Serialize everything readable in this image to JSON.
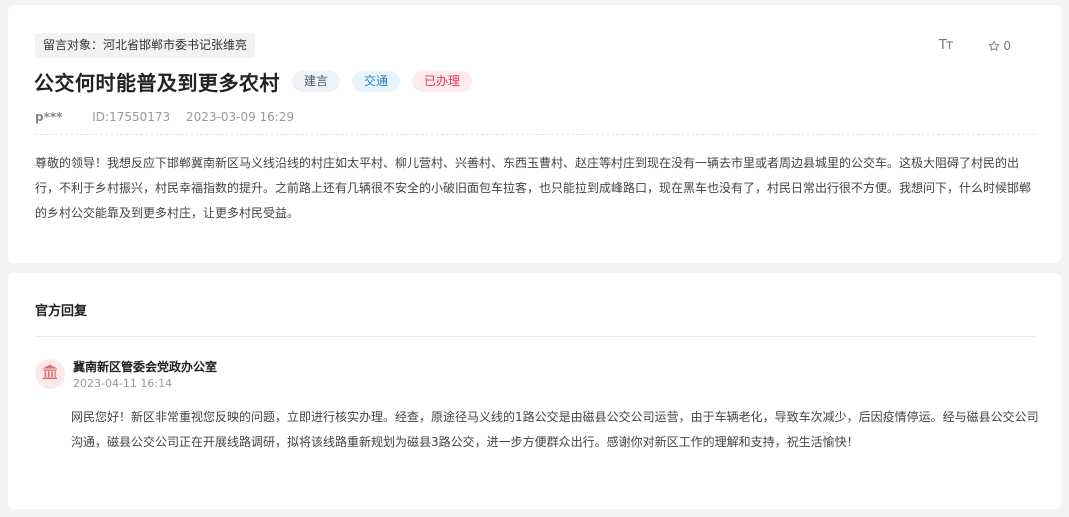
{
  "message": {
    "target": "留言对象：河北省邯郸市委书记张维亮",
    "title": "公交何时能普及到更多农村",
    "tags": [
      "建言",
      "交通",
      "已办理"
    ],
    "tools": {
      "font_icon": "Tт",
      "favorite_count": "0"
    },
    "author": "p***",
    "id_text": "ID:17550173",
    "timestamp": "2023-03-09 16:29",
    "content": "尊敬的领导！我想反应下邯郸冀南新区马义线沿线的村庄如太平村、柳儿营村、兴善村、东西玉曹村、赵庄等村庄到现在没有一辆去市里或者周边县城里的公交车。这极大阻碍了村民的出行，不利于乡村振兴，村民幸福指数的提升。之前路上还有几辆很不安全的小破旧面包车拉客，也只能拉到成峰路口，现在黑车也没有了，村民日常出行很不方便。我想问下，什么时候邯郸的乡村公交能靠及到更多村庄，让更多村民受益。"
  },
  "reply": {
    "heading": "官方回复",
    "org_name": "冀南新区管委会党政办公室",
    "timestamp": "2023-04-11 16:14",
    "content": "网民您好！新区非常重视您反映的问题，立即进行核实办理。经查，原途径马义线的1路公交是由磁县公交公司运营，由于车辆老化，导致车次减少，后因疫情停运。经与磁县公交公司沟通，磁县公交公司正在开展线路调研，拟将该线路重新规划为磁县3路公交，进一步方便群众出行。感谢你对新区工作的理解和支持，祝生活愉快！"
  },
  "icons": {
    "font_size": "font-size-icon",
    "favorite": "star-icon",
    "org": "government-building-icon"
  },
  "colors": {
    "tag_suggest": "#4a5b73",
    "tag_traffic": "#2b7fc4",
    "tag_done": "#e5344f",
    "org_icon": "#e07070"
  }
}
